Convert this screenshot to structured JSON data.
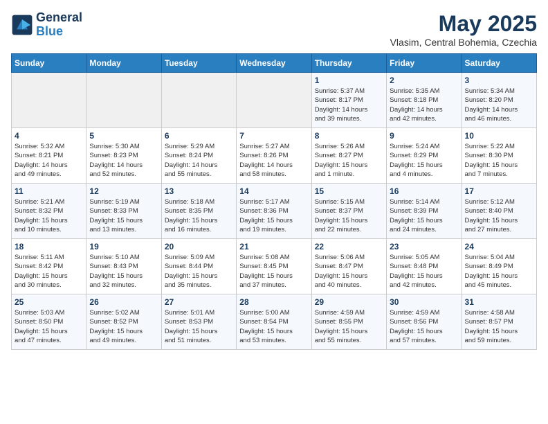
{
  "logo": {
    "line1": "General",
    "line2": "Blue"
  },
  "title": "May 2025",
  "location": "Vlasim, Central Bohemia, Czechia",
  "weekdays": [
    "Sunday",
    "Monday",
    "Tuesday",
    "Wednesday",
    "Thursday",
    "Friday",
    "Saturday"
  ],
  "weeks": [
    [
      {
        "day": "",
        "info": ""
      },
      {
        "day": "",
        "info": ""
      },
      {
        "day": "",
        "info": ""
      },
      {
        "day": "",
        "info": ""
      },
      {
        "day": "1",
        "info": "Sunrise: 5:37 AM\nSunset: 8:17 PM\nDaylight: 14 hours\nand 39 minutes."
      },
      {
        "day": "2",
        "info": "Sunrise: 5:35 AM\nSunset: 8:18 PM\nDaylight: 14 hours\nand 42 minutes."
      },
      {
        "day": "3",
        "info": "Sunrise: 5:34 AM\nSunset: 8:20 PM\nDaylight: 14 hours\nand 46 minutes."
      }
    ],
    [
      {
        "day": "4",
        "info": "Sunrise: 5:32 AM\nSunset: 8:21 PM\nDaylight: 14 hours\nand 49 minutes."
      },
      {
        "day": "5",
        "info": "Sunrise: 5:30 AM\nSunset: 8:23 PM\nDaylight: 14 hours\nand 52 minutes."
      },
      {
        "day": "6",
        "info": "Sunrise: 5:29 AM\nSunset: 8:24 PM\nDaylight: 14 hours\nand 55 minutes."
      },
      {
        "day": "7",
        "info": "Sunrise: 5:27 AM\nSunset: 8:26 PM\nDaylight: 14 hours\nand 58 minutes."
      },
      {
        "day": "8",
        "info": "Sunrise: 5:26 AM\nSunset: 8:27 PM\nDaylight: 15 hours\nand 1 minute."
      },
      {
        "day": "9",
        "info": "Sunrise: 5:24 AM\nSunset: 8:29 PM\nDaylight: 15 hours\nand 4 minutes."
      },
      {
        "day": "10",
        "info": "Sunrise: 5:22 AM\nSunset: 8:30 PM\nDaylight: 15 hours\nand 7 minutes."
      }
    ],
    [
      {
        "day": "11",
        "info": "Sunrise: 5:21 AM\nSunset: 8:32 PM\nDaylight: 15 hours\nand 10 minutes."
      },
      {
        "day": "12",
        "info": "Sunrise: 5:19 AM\nSunset: 8:33 PM\nDaylight: 15 hours\nand 13 minutes."
      },
      {
        "day": "13",
        "info": "Sunrise: 5:18 AM\nSunset: 8:35 PM\nDaylight: 15 hours\nand 16 minutes."
      },
      {
        "day": "14",
        "info": "Sunrise: 5:17 AM\nSunset: 8:36 PM\nDaylight: 15 hours\nand 19 minutes."
      },
      {
        "day": "15",
        "info": "Sunrise: 5:15 AM\nSunset: 8:37 PM\nDaylight: 15 hours\nand 22 minutes."
      },
      {
        "day": "16",
        "info": "Sunrise: 5:14 AM\nSunset: 8:39 PM\nDaylight: 15 hours\nand 24 minutes."
      },
      {
        "day": "17",
        "info": "Sunrise: 5:12 AM\nSunset: 8:40 PM\nDaylight: 15 hours\nand 27 minutes."
      }
    ],
    [
      {
        "day": "18",
        "info": "Sunrise: 5:11 AM\nSunset: 8:42 PM\nDaylight: 15 hours\nand 30 minutes."
      },
      {
        "day": "19",
        "info": "Sunrise: 5:10 AM\nSunset: 8:43 PM\nDaylight: 15 hours\nand 32 minutes."
      },
      {
        "day": "20",
        "info": "Sunrise: 5:09 AM\nSunset: 8:44 PM\nDaylight: 15 hours\nand 35 minutes."
      },
      {
        "day": "21",
        "info": "Sunrise: 5:08 AM\nSunset: 8:45 PM\nDaylight: 15 hours\nand 37 minutes."
      },
      {
        "day": "22",
        "info": "Sunrise: 5:06 AM\nSunset: 8:47 PM\nDaylight: 15 hours\nand 40 minutes."
      },
      {
        "day": "23",
        "info": "Sunrise: 5:05 AM\nSunset: 8:48 PM\nDaylight: 15 hours\nand 42 minutes."
      },
      {
        "day": "24",
        "info": "Sunrise: 5:04 AM\nSunset: 8:49 PM\nDaylight: 15 hours\nand 45 minutes."
      }
    ],
    [
      {
        "day": "25",
        "info": "Sunrise: 5:03 AM\nSunset: 8:50 PM\nDaylight: 15 hours\nand 47 minutes."
      },
      {
        "day": "26",
        "info": "Sunrise: 5:02 AM\nSunset: 8:52 PM\nDaylight: 15 hours\nand 49 minutes."
      },
      {
        "day": "27",
        "info": "Sunrise: 5:01 AM\nSunset: 8:53 PM\nDaylight: 15 hours\nand 51 minutes."
      },
      {
        "day": "28",
        "info": "Sunrise: 5:00 AM\nSunset: 8:54 PM\nDaylight: 15 hours\nand 53 minutes."
      },
      {
        "day": "29",
        "info": "Sunrise: 4:59 AM\nSunset: 8:55 PM\nDaylight: 15 hours\nand 55 minutes."
      },
      {
        "day": "30",
        "info": "Sunrise: 4:59 AM\nSunset: 8:56 PM\nDaylight: 15 hours\nand 57 minutes."
      },
      {
        "day": "31",
        "info": "Sunrise: 4:58 AM\nSunset: 8:57 PM\nDaylight: 15 hours\nand 59 minutes."
      }
    ]
  ]
}
